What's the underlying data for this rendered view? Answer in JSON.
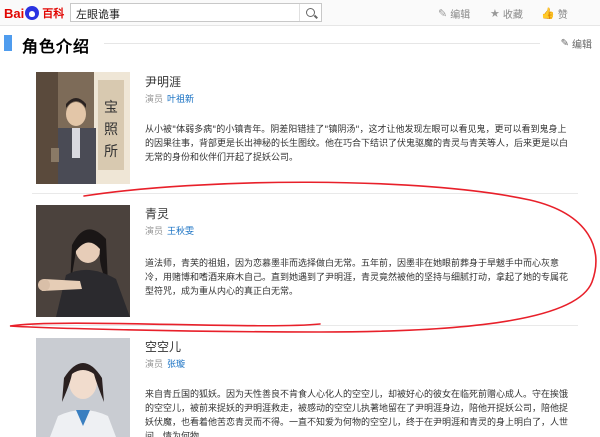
{
  "header": {
    "logo_bai": "Bai",
    "logo_baike": "百科",
    "search_query": "左眼诡事",
    "edit_label": "编辑",
    "collect_label": "收藏",
    "like_label": "赞"
  },
  "section": {
    "title": "角色介绍",
    "edit_label": "编辑"
  },
  "characters": [
    {
      "name": "尹明涯",
      "actor_label": "演员",
      "actor": "叶祖新",
      "desc": "从小被\"体弱多病\"的小镇青年。阴差阳错挂了\"镇阴汤\"，这才让他发现左眼可以看见鬼，更可以看到鬼身上的因果往事，背部更是长出神秘的长生图纹。他在巧合下结识了伏鬼驱魔的青灵与青芙等人，后来更是以白无常的身份和伙伴们开起了捉妖公司。"
    },
    {
      "name": "青灵",
      "actor_label": "演员",
      "actor": "王秋雯",
      "desc": "道法师，青芙的祖姐，因为恋慕墨非而选择做白无常。五年前，因墨非在她眼前葬身于旱魃手中而心灰意冷，用赌博和嗜酒来麻木自己。直到她遇到了尹明涯，青灵竟然被他的坚持与细腻打动，拿起了她的专属花型符咒，成为重从内心的真正白无常。"
    },
    {
      "name": "空空儿",
      "actor_label": "演员",
      "actor": "张璇",
      "desc": "来自青丘国的狐妖。因为天性善良不肯食人心化人的空空儿，却被好心的彼女在临死前赠心成人。守在挨饿的空空儿，被前来捉妖的尹明涯救走，被感动的空空儿执著地留在了尹明涯身边，陪他开捉妖公司，陪他捉妖伏魔，也看着他苦恋青灵而不得。一直不知爱为何物的空空儿，终于在尹明涯和青灵的身上明白了，人世间，情为何物。"
    }
  ],
  "colors": {
    "accent_blue": "#4f9cee",
    "link_blue": "#136ec2",
    "annotation_red": "#e8202a"
  }
}
